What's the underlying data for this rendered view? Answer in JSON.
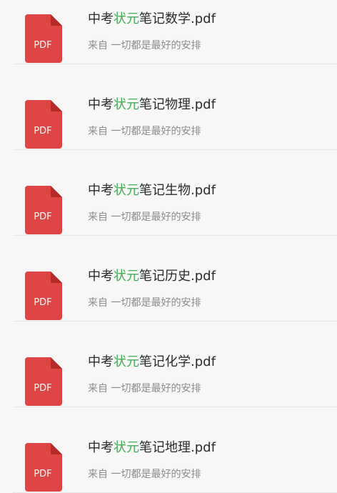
{
  "colors": {
    "background": "#f7f7f7",
    "highlight": "#3fae55",
    "pdf_red": "#e04546",
    "title_text": "#2b2b2b",
    "source_text": "#8c8c8c",
    "divider": "#e6e6e6"
  },
  "icon": {
    "type": "pdf-file-icon",
    "label": "PDF"
  },
  "files": [
    {
      "name_prefix": "中考",
      "name_highlight": "状元",
      "name_suffix": "笔记数学.pdf",
      "source": "来自 一切都是最好的安排"
    },
    {
      "name_prefix": "中考",
      "name_highlight": "状元",
      "name_suffix": "笔记物理.pdf",
      "source": "来自 一切都是最好的安排"
    },
    {
      "name_prefix": "中考",
      "name_highlight": "状元",
      "name_suffix": "笔记生物.pdf",
      "source": "来自 一切都是最好的安排"
    },
    {
      "name_prefix": "中考",
      "name_highlight": "状元",
      "name_suffix": "笔记历史.pdf",
      "source": "来自 一切都是最好的安排"
    },
    {
      "name_prefix": "中考",
      "name_highlight": "状元",
      "name_suffix": "笔记化学.pdf",
      "source": "来自 一切都是最好的安排"
    },
    {
      "name_prefix": "中考",
      "name_highlight": "状元",
      "name_suffix": "笔记地理.pdf",
      "source": "来自 一切都是最好的安排"
    }
  ]
}
